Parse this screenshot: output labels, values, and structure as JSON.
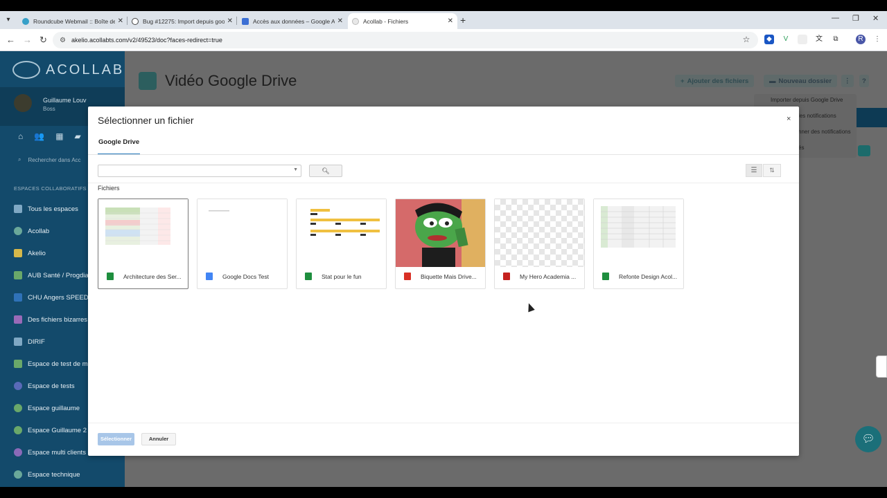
{
  "browser": {
    "tabs": [
      {
        "label": "Roundcube Webmail :: Boîte de",
        "color": "#37a0c8"
      },
      {
        "label": "Bug #12275: Import depuis goo",
        "color": "#444444"
      },
      {
        "label": "Accès aux données – Google A",
        "color": "#3b6fd4"
      },
      {
        "label": "Acollab - Fichiers",
        "color": "#cccccc"
      }
    ],
    "url": "akelio.acollabts.com/v2/49523/doc?faces-redirect=true",
    "profile_initial": "R"
  },
  "app": {
    "logo_text": "ACOLLAB",
    "user": {
      "name": "Guillaume Louv",
      "role": "Boss"
    },
    "search_placeholder": "Rechercher dans Acc",
    "section_title": "ESPACES COLLABORATIFS",
    "spaces": [
      {
        "label": "Tous les espaces",
        "color": "#7fa8c4"
      },
      {
        "label": "Acollab",
        "color": "#6aa89a"
      },
      {
        "label": "Akelio",
        "color": "#d6b84a"
      },
      {
        "label": "AUB Santé / Progdial",
        "color": "#6aa86a"
      },
      {
        "label": "CHU Angers SPEED",
        "color": "#2f72b8"
      },
      {
        "label": "Des fichiers bizarres",
        "color": "#9a6ab8"
      },
      {
        "label": "DIRIF",
        "color": "#7fa8c4"
      },
      {
        "label": "Espace de test de mé",
        "color": "#6aa86a"
      },
      {
        "label": "Espace de tests",
        "color": "#5a6ab8"
      },
      {
        "label": "Espace guillaume",
        "color": "#6aa86a"
      },
      {
        "label": "Espace Guillaume 2",
        "color": "#6aa86a"
      },
      {
        "label": "Espace multi clients",
        "color": "#8a6ab8"
      },
      {
        "label": "Espace technique",
        "color": "#6aa89a"
      }
    ],
    "page_title": "Vidéo Google Drive",
    "add_files_label": "Ajouter des fichiers",
    "new_folder_label": "Nouveau dossier",
    "help_label": "?",
    "menu_items": [
      "Importer depuis Google Drive",
      "les notifications",
      "nner des notifications",
      "és"
    ]
  },
  "modal": {
    "title": "Sélectionner un fichier",
    "close_label": "×",
    "tab_label": "Google Drive",
    "search_value": "",
    "files_label": "Fichiers",
    "files": [
      {
        "name": "Architecture des Ser...",
        "type": "sheets",
        "selected": true
      },
      {
        "name": "Google Docs Test",
        "type": "docs",
        "selected": false
      },
      {
        "name": "Stat pour le fun",
        "type": "sheets",
        "selected": false
      },
      {
        "name": "Biquette Mais Drive...",
        "type": "image",
        "selected": false
      },
      {
        "name": "My Hero Academia ...",
        "type": "pdf",
        "selected": false
      },
      {
        "name": "Refonte Design Acol...",
        "type": "sheets",
        "selected": false
      }
    ],
    "select_button": "Sélectionner",
    "cancel_button": "Annuler"
  },
  "colors": {
    "sidebar": "#134a6b",
    "sheets_icon": "#1e8e3e",
    "docs_icon": "#4285f4",
    "image_icon": "#d93025",
    "pdf_icon": "#c5221f",
    "primary_disabled": "#a8c6e8"
  }
}
